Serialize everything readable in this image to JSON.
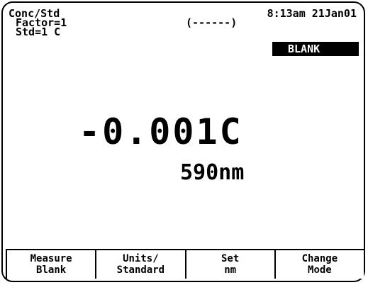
{
  "header": {
    "mode_title": "Conc/Std",
    "factor": "Factor=1",
    "standard": "Std=1 C",
    "status_indicator": "(------)",
    "time": "8:13am",
    "date": "21Jan01",
    "badge": "BLANK"
  },
  "display": {
    "reading": "-0.001C",
    "wavelength": "590nm"
  },
  "softkeys": [
    {
      "line1": "Measure",
      "line2": "Blank"
    },
    {
      "line1": "Units/",
      "line2": "Standard"
    },
    {
      "line1": "Set",
      "line2": "nm"
    },
    {
      "line1": "Change",
      "line2": "Mode"
    }
  ],
  "colors": {
    "background": "#ffffff",
    "foreground": "#000000"
  }
}
